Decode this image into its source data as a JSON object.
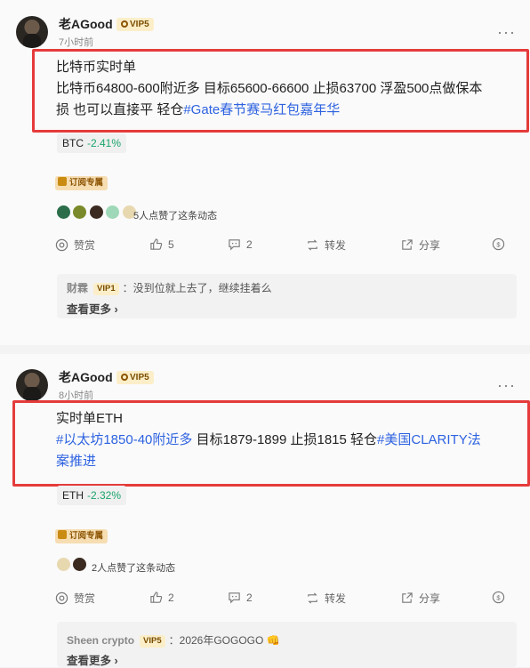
{
  "posts": [
    {
      "author": "老AGood",
      "vip": "VIP5",
      "time": "7小时前",
      "more": "···",
      "lines": [
        "比特币实时单",
        "比特币64800-600附近多 目标65600-66600 止损63700 浮盈500点做保本",
        "损 也可以直接平 轻仓"
      ],
      "tags": [
        "#Gate春节赛马红包嘉年华"
      ],
      "coin": {
        "symbol": "BTC",
        "change": "-2.41%"
      },
      "subscribe_label": "订阅专属",
      "likes_text": "5人点赞了这条动态",
      "actions": {
        "reward": "赞赏",
        "like": "5",
        "comment": "2",
        "repost": "转发",
        "share": "分享"
      },
      "comment": {
        "user": "财霖",
        "vip": "VIP1",
        "text": "：没到位就上去了，继续挂着么"
      },
      "see_more": "查看更多 ›"
    },
    {
      "author": "老AGood",
      "vip": "VIP5",
      "time": "8小时前",
      "more": "···",
      "lines": [
        "实时单ETH"
      ],
      "tag1": "#以太坊1850-40附近多",
      "text_mid": " 目标1879-1899 止损1815 轻仓",
      "tag2": "#美国CLARITY法",
      "tag2_cont": "案推进",
      "coin": {
        "symbol": "ETH",
        "change": "-2.32%"
      },
      "subscribe_label": "订阅专属",
      "likes_text": "2人点赞了这条动态",
      "actions": {
        "reward": "赞赏",
        "like": "2",
        "comment": "2",
        "repost": "转发",
        "share": "分享"
      },
      "comment": {
        "user": "Sheen crypto",
        "vip": "VIP5",
        "text": "：2026年GOGOGO 👊"
      },
      "see_more": "查看更多 ›"
    }
  ],
  "colors": {
    "highlight_border": "#e53b3b",
    "tag": "#2d62e0",
    "positive": "#1aa46a",
    "vip_bg": "#fbeec8"
  }
}
